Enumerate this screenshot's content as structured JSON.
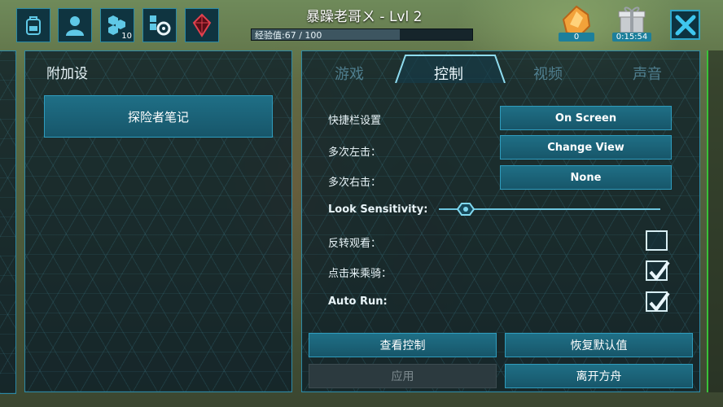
{
  "top_bar": {
    "player_name": "暴躁老哥ㄨ - Lvl 2",
    "xp_label": "经验值:67 / 100",
    "xp_fraction": 0.67,
    "engram_count": "10",
    "gem_count": "0",
    "gift_timer": "0:15:54",
    "icons": [
      "inventory-icon",
      "character-icon",
      "engrams-icon",
      "tribe-settings-icon",
      "tek-crystal-icon"
    ]
  },
  "left_panel": {
    "title": "附加设",
    "explorer_notes_button": "探险者笔记"
  },
  "tabs": [
    {
      "label": "游戏",
      "active": false
    },
    {
      "label": "控制",
      "active": true
    },
    {
      "label": "视频",
      "active": false
    },
    {
      "label": "声音",
      "active": false
    }
  ],
  "controls": {
    "hotbar_label": "快捷栏设置",
    "hotbar_value": "On Screen",
    "multi_left_label": "多次左击：",
    "multi_left_value": "Change View",
    "multi_right_label": "多次右击：",
    "multi_right_value": "None",
    "look_sensitivity_label": "Look Sensitivity:",
    "look_sensitivity_value": 0.12,
    "invert_look_label": "反转观看：",
    "invert_look_checked": false,
    "tap_to_ride_label": "点击来乘骑：",
    "tap_to_ride_checked": true,
    "auto_run_label": "Auto Run:",
    "auto_run_checked": true
  },
  "footer_buttons": {
    "view_controls": "查看控制",
    "restore_defaults": "恢复默认值",
    "apply": "应用",
    "leave_ark": "离开方舟"
  },
  "colors": {
    "accent": "#2f9cbd",
    "button": "#1f6f86",
    "panel": "#0c1e28"
  }
}
